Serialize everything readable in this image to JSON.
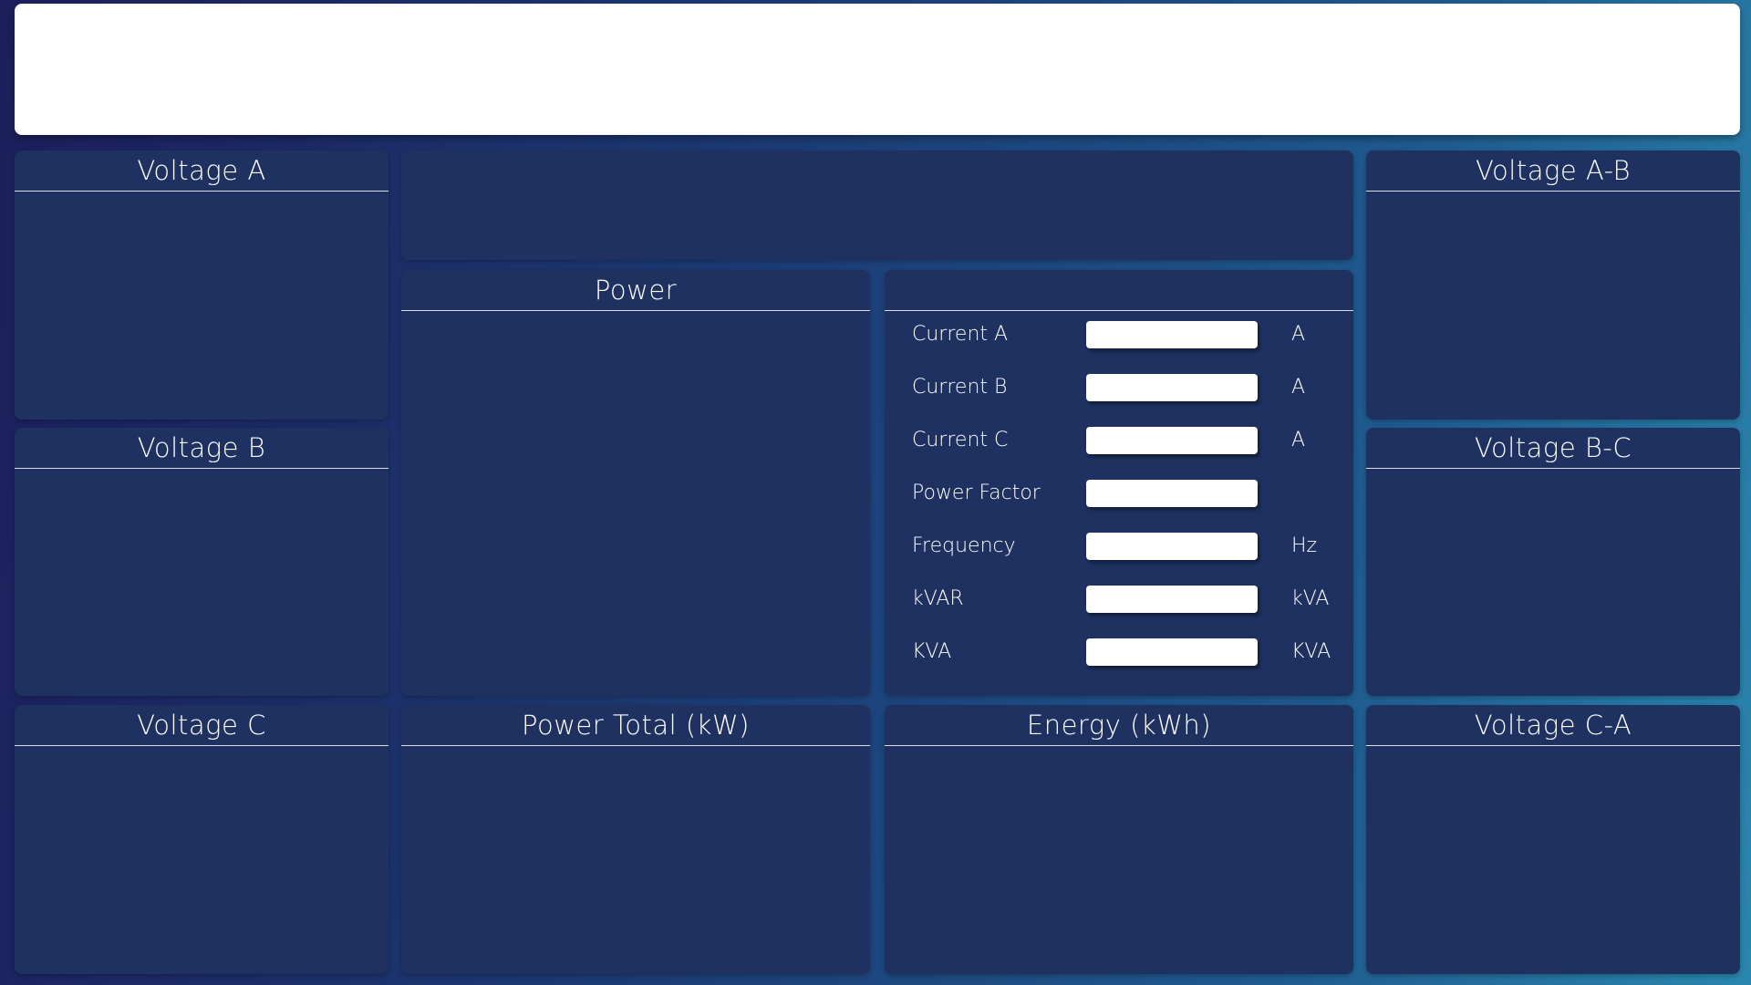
{
  "panels": {
    "voltage_a": "Voltage A",
    "voltage_b": "Voltage B",
    "voltage_c": "Voltage C",
    "power": "Power",
    "power_total": "Power Total (kW)",
    "energy": "Energy (kWh)",
    "voltage_ab": "Voltage A-B",
    "voltage_bc": "Voltage B-C",
    "voltage_ca": "Voltage C-A"
  },
  "metrics": [
    {
      "label": "Current A",
      "value": "",
      "unit": "A"
    },
    {
      "label": "Current B",
      "value": "",
      "unit": "A"
    },
    {
      "label": "Current C",
      "value": "",
      "unit": "A"
    },
    {
      "label": "Power Factor",
      "value": "",
      "unit": ""
    },
    {
      "label": "Frequency",
      "value": "",
      "unit": "Hz"
    },
    {
      "label": "kVAR",
      "value": "",
      "unit": "kVA"
    },
    {
      "label": "KVA",
      "value": "",
      "unit": "KVA"
    }
  ]
}
